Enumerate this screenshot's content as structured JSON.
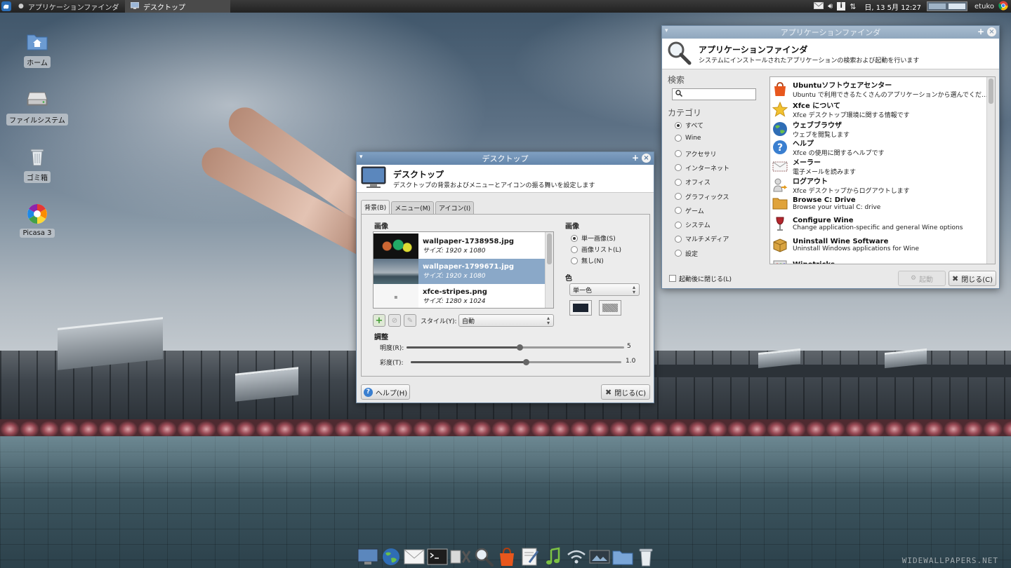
{
  "top_panel": {
    "tasks": [
      {
        "label": "アプリケーションファインダ",
        "icon": "magnifier-icon"
      },
      {
        "label": "デスクトップ",
        "icon": "desktop-monitor-icon"
      }
    ],
    "clock": "日, 13 5月  12:27",
    "user": "etuko",
    "tray_icons": [
      "mail-icon",
      "volume-icon",
      "info-icon",
      "network-arrows-icon",
      "chrome-icon"
    ]
  },
  "desktop_icons": [
    {
      "label": "ホーム",
      "icon": "home-folder-icon"
    },
    {
      "label": "ファイルシステム",
      "icon": "drive-icon"
    },
    {
      "label": "ゴミ箱",
      "icon": "trash-icon"
    },
    {
      "label": "Picasa 3",
      "icon": "picasa-icon"
    }
  ],
  "desktop_window": {
    "title": "デスクトップ",
    "header_title": "デスクトップ",
    "header_subtitle": "デスクトップの背景およびメニューとアイコンの振る舞いを設定します",
    "tabs": [
      "背景(B)",
      "メニュー(M)",
      "アイコン(I)"
    ],
    "image_section_label": "画像",
    "wallpapers": [
      {
        "name": "wallpaper-1738958.jpg",
        "size": "サイズ: 1920 x 1080",
        "selected": false
      },
      {
        "name": "wallpaper-1799671.jpg",
        "size": "サイズ: 1920 x 1080",
        "selected": true
      },
      {
        "name": "xfce-stripes.png",
        "size": "サイズ: 1280 x 1024",
        "selected": false
      }
    ],
    "style_label": "スタイル(Y):",
    "style_value": "自動",
    "image_mode_label": "画像",
    "image_modes": [
      {
        "label": "単一画像(S)",
        "checked": true
      },
      {
        "label": "画像リスト(L)",
        "checked": false
      },
      {
        "label": "無し(N)",
        "checked": false
      }
    ],
    "color_label": "色",
    "color_value": "単一色",
    "adjust_label": "調整",
    "brightness_label": "明度(R):",
    "brightness_value": "5",
    "brightness_fraction": 0.52,
    "saturation_label": "彩度(T):",
    "saturation_value": "1.0",
    "saturation_fraction": 0.545,
    "help_button": "ヘルプ(H)",
    "close_button": "閉じる(C)",
    "primary_color": "#1b2330"
  },
  "app_finder": {
    "title": "アプリケーションファインダ",
    "header_title": "アプリケーションファインダ",
    "header_subtitle": "システムにインストールされたアプリケーションの検索および起動を行います",
    "search_label": "検索",
    "search_value": "",
    "category_label": "カテゴリ",
    "categories": [
      {
        "label": "すべて",
        "checked": true
      },
      {
        "label": "Wine",
        "checked": false
      },
      {
        "label": "アクセサリ",
        "checked": false
      },
      {
        "label": "インターネット",
        "checked": false
      },
      {
        "label": "オフィス",
        "checked": false
      },
      {
        "label": "グラフィックス",
        "checked": false
      },
      {
        "label": "ゲーム",
        "checked": false
      },
      {
        "label": "システム",
        "checked": false
      },
      {
        "label": "マルチメディア",
        "checked": false
      },
      {
        "label": "設定",
        "checked": false
      }
    ],
    "apps": [
      {
        "name": "Ubuntuソフトウェアセンター",
        "desc": "Ubuntu で利用できるたくさんのアプリケーションから選んでくだ...",
        "icon": "software-center-bag-icon"
      },
      {
        "name": "Xfce について",
        "desc": "Xfce デスクトップ環境に関する情報です",
        "icon": "star-icon"
      },
      {
        "name": "ウェブブラウザ",
        "desc": "ウェブを閲覧します",
        "icon": "globe-icon"
      },
      {
        "name": "ヘルプ",
        "desc": "Xfce の使用に関するヘルプです",
        "icon": "help-icon"
      },
      {
        "name": "メーラー",
        "desc": "電子メールを読みます",
        "icon": "mail-envelope-icon"
      },
      {
        "name": "ログアウト",
        "desc": "Xfce デスクトップからログアウトします",
        "icon": "logout-icon"
      },
      {
        "name": "Browse C: Drive",
        "desc": "Browse your virtual C: drive",
        "icon": "folder-icon"
      },
      {
        "name": "Configure Wine",
        "desc": "Change application-specific and general Wine options",
        "icon": "wine-glass-icon"
      },
      {
        "name": "Uninstall Wine Software",
        "desc": "Uninstall Windows applications for Wine",
        "icon": "package-icon"
      },
      {
        "name": "Winetricks",
        "desc": "",
        "icon": "winetricks-icon"
      }
    ],
    "close_after_launch_label": "起動後に閉じる(L)",
    "launch_button": "起動",
    "close_button": "閉じる(C)"
  },
  "dock_items": [
    "desktop-icon",
    "web-browser-icon",
    "mail-icon",
    "terminal-icon",
    "settings-tools-icon",
    "magnifier-icon",
    "software-center-icon",
    "text-editor-icon",
    "music-note-icon",
    "network-wifi-icon",
    "image-viewer-icon",
    "folder-icon",
    "trash-icon"
  ],
  "wallpaper_credit": "WIDEWALLPAPERS.NET",
  "colors": {
    "titlebar": "#6f8fb4",
    "selection": "#8aa8c8",
    "panel": "#2b2b2b"
  }
}
